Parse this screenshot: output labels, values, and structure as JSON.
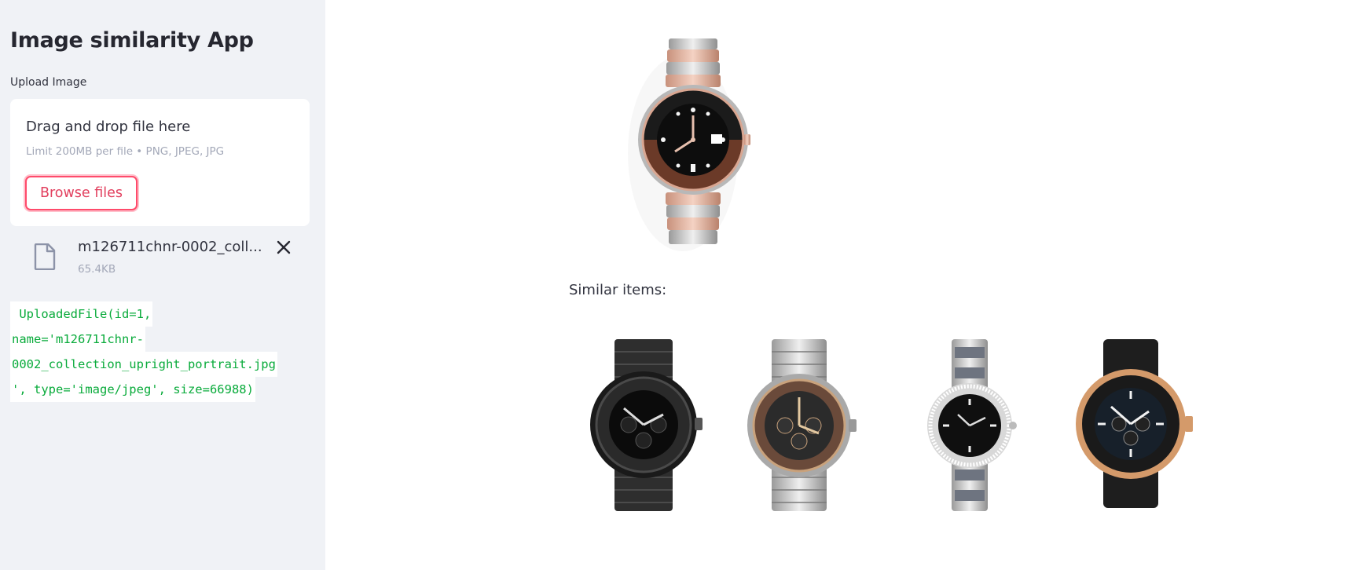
{
  "sidebar": {
    "title": "Image similarity App",
    "upload_label": "Upload Image",
    "dropzone": {
      "title": "Drag and drop file here",
      "limit": "Limit 200MB per file • PNG, JPEG, JPG",
      "browse_label": "Browse files"
    },
    "file": {
      "name": "m126711chnr-0002_coll...",
      "size": "65.4KB"
    },
    "code_lines": [
      " UploadedFile(id=1,",
      "name='m126711chnr-",
      "0002_collection_upright_portrait.jpg",
      "', type='image/jpeg', size=66988)"
    ]
  },
  "main": {
    "similar_label": "Similar items:"
  },
  "colors": {
    "accent": "#ff4b6b",
    "sidebar_bg": "#f0f2f6",
    "code_green": "#09ab3b"
  }
}
